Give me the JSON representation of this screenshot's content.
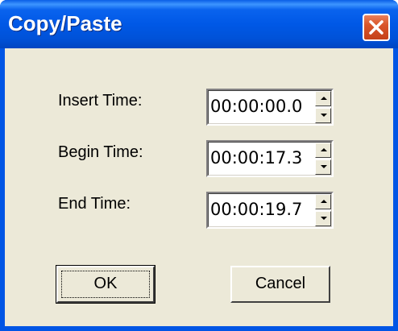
{
  "window": {
    "title": "Copy/Paste"
  },
  "fields": [
    {
      "label": "Insert Time:",
      "value": "00:00:00.0"
    },
    {
      "label": "Begin Time:",
      "value": "00:00:17.3"
    },
    {
      "label": "End Time:",
      "value": "00:00:19.7"
    }
  ],
  "buttons": {
    "ok_label": "OK",
    "cancel_label": "Cancel"
  },
  "icons": {
    "close": "close-icon",
    "up": "spin-up-icon",
    "down": "spin-down-icon"
  },
  "colors": {
    "titlebar": "#0058e6",
    "close": "#d9552a",
    "dialog_bg": "#ece9d8"
  }
}
